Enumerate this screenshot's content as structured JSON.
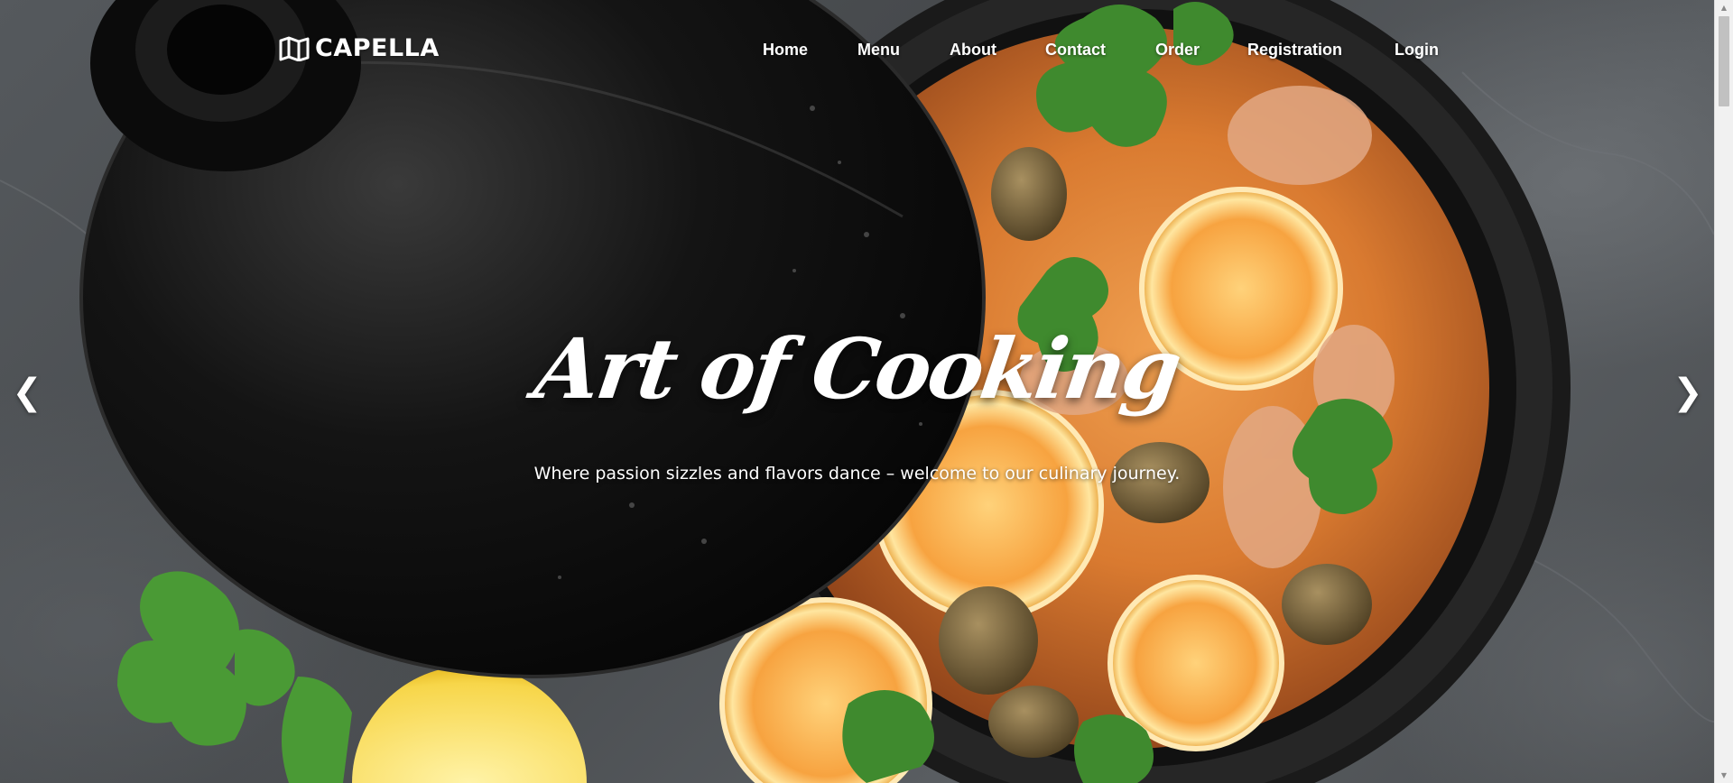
{
  "brand": {
    "name": "CAPELLA",
    "icon": "map-icon"
  },
  "nav": {
    "items": [
      {
        "label": "Home"
      },
      {
        "label": "Menu"
      },
      {
        "label": "About"
      },
      {
        "label": "Contact"
      },
      {
        "label": "Order"
      },
      {
        "label": "Registration"
      },
      {
        "label": "Login"
      }
    ]
  },
  "hero": {
    "title": "Art of Cooking",
    "subtitle": "Where passion sizzles and flavors dance – welcome to our culinary journey.",
    "prev_arrow": "❮",
    "next_arrow": "❯"
  },
  "colors": {
    "text": "#ffffff",
    "background": "#4a4d50",
    "tagine_lid": "#0d0d0d",
    "sauce": "#e08a3a",
    "lemon": "#f5c542",
    "cilantro": "#3f8a2e"
  },
  "scrollbar": {
    "up_icon": "▲",
    "down_icon": "▼"
  }
}
